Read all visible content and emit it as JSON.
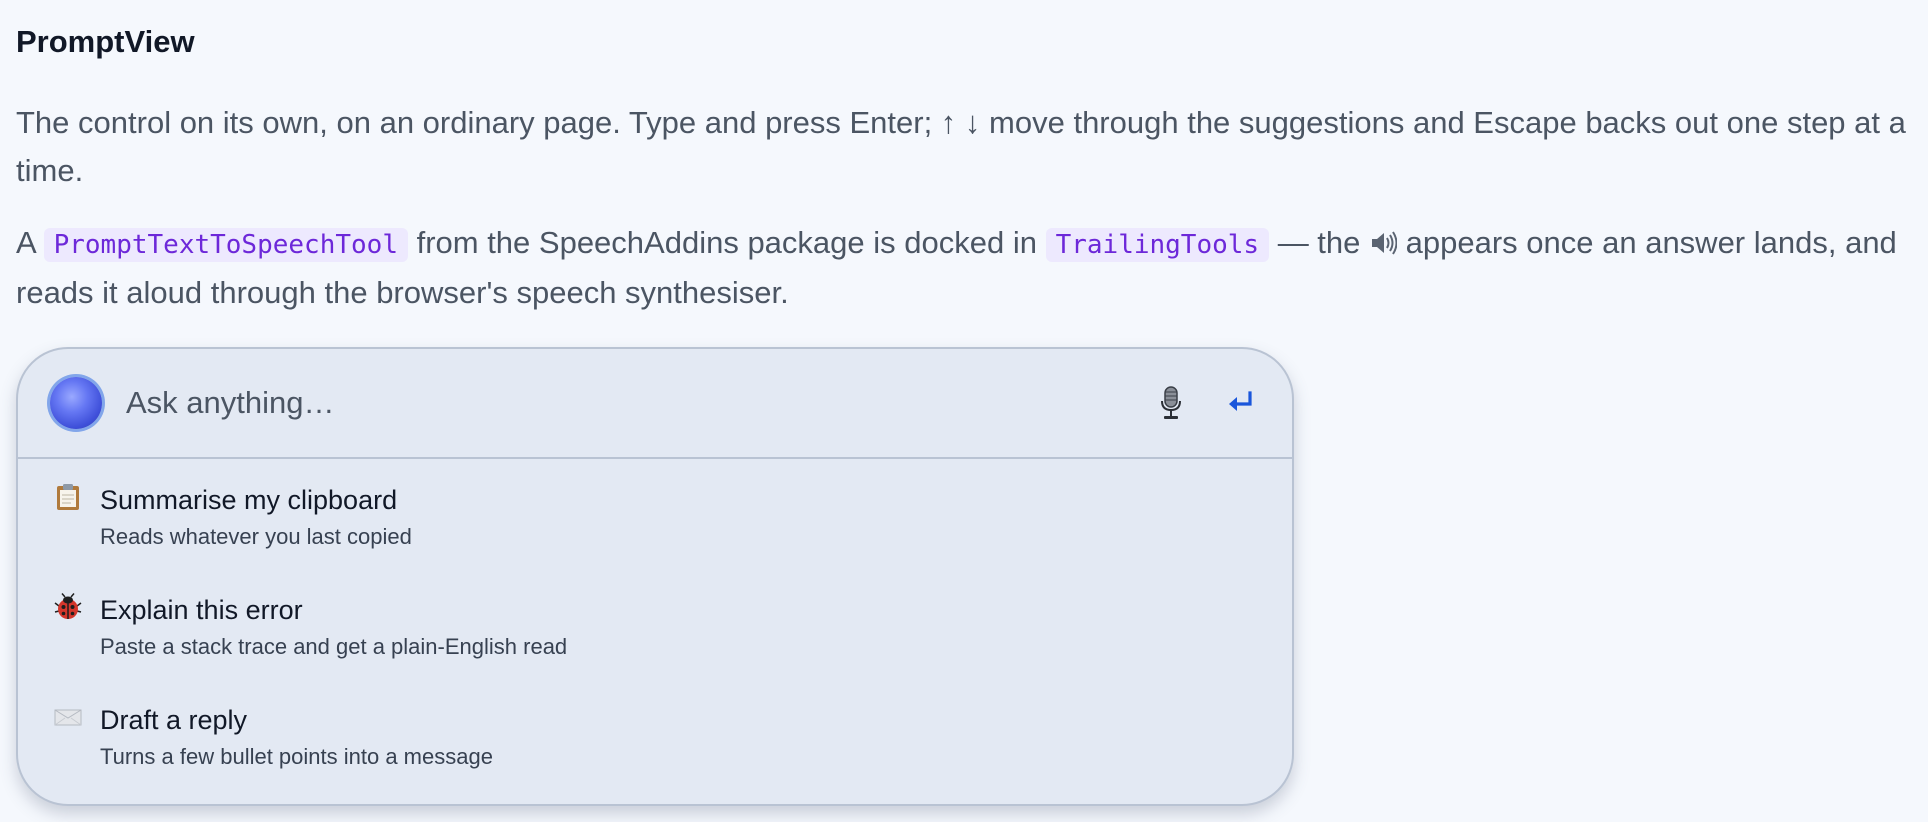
{
  "page": {
    "title": "PromptView",
    "para1": "The control on its own, on an ordinary page. Type and press Enter; ↑ ↓ move through the suggestions and Escape backs out one step at a time.",
    "para2_start": "A ",
    "para2_code1": "PromptTextToSpeechTool",
    "para2_mid": " from the SpeechAddins package is docked in ",
    "para2_code2": "TrailingTools",
    "para2_mid2": " — the ",
    "para2_end": " appears once an answer lands, and reads it aloud through the browser's speech synthesiser."
  },
  "prompt": {
    "placeholder": "Ask anything…",
    "icons": {
      "orb": "assistant-orb-icon",
      "mic": "microphone-icon",
      "submit": "enter-return-icon"
    },
    "accent": "#1a56db"
  },
  "suggestions": [
    {
      "icon": "clipboard-icon",
      "title": "Summarise my clipboard",
      "description": "Reads whatever you last copied"
    },
    {
      "icon": "ladybug-icon",
      "title": "Explain this error",
      "description": "Paste a stack trace and get a plain-English read"
    },
    {
      "icon": "envelope-icon",
      "title": "Draft a reply",
      "description": "Turns a few bullet points into a message"
    }
  ]
}
